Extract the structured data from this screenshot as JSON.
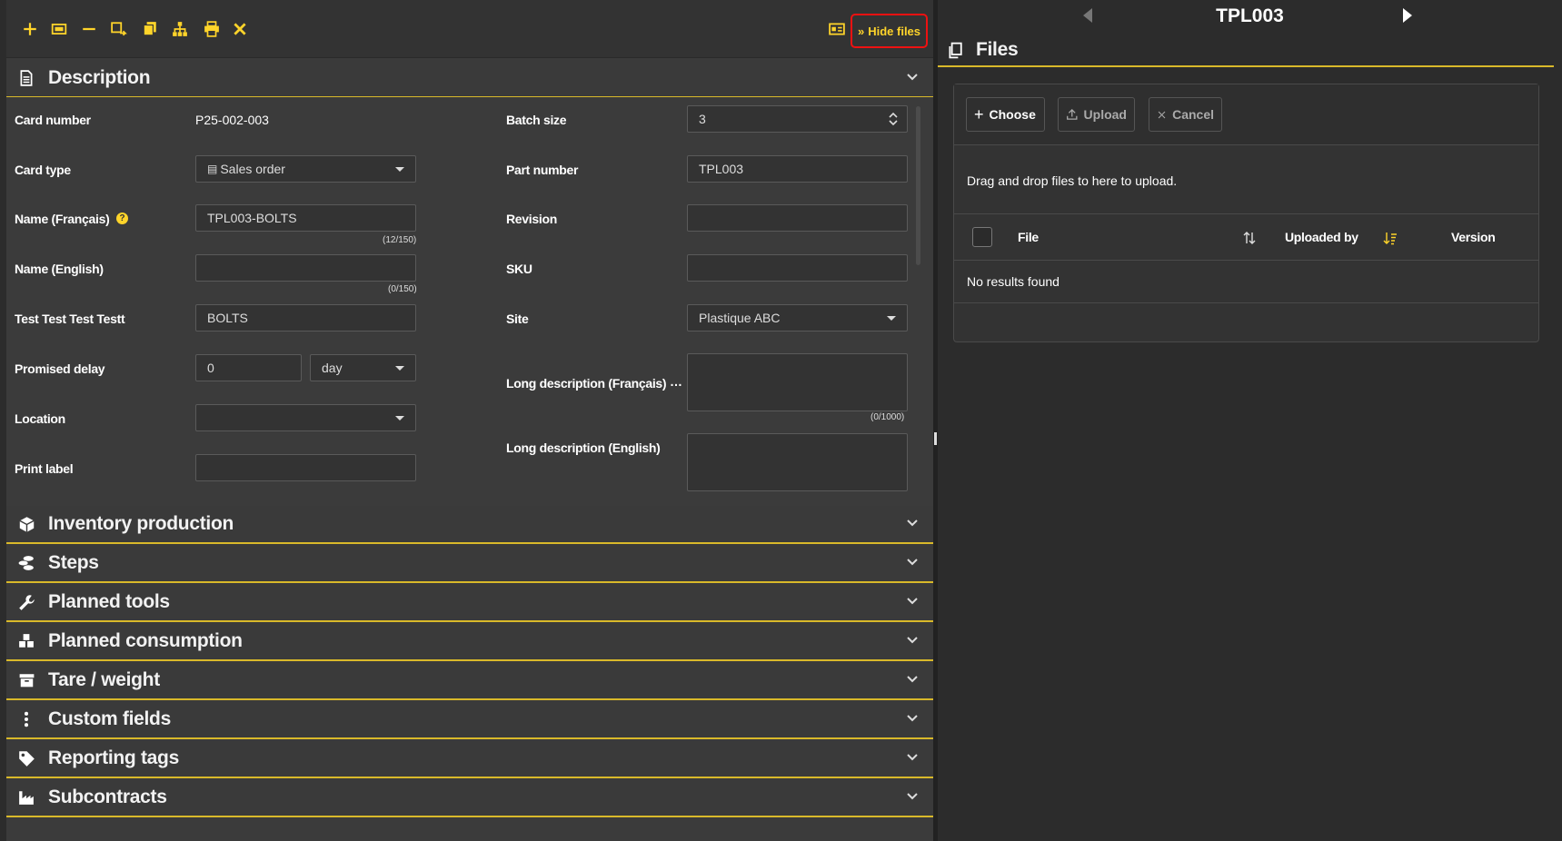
{
  "toolbar": {
    "buttons": [
      {
        "icon": "plus-icon"
      },
      {
        "icon": "card-icon"
      },
      {
        "icon": "minus-icon"
      },
      {
        "icon": "copy-move-icon"
      },
      {
        "icon": "duplicate-icon"
      },
      {
        "icon": "hierarchy-icon"
      },
      {
        "icon": "print-icon"
      },
      {
        "icon": "close-icon"
      }
    ],
    "hide_files_label": "Hide files"
  },
  "description": {
    "title": "Description",
    "left": {
      "card_number_label": "Card number",
      "card_number_value": "P25-002-003",
      "card_type_label": "Card type",
      "card_type_value": "Sales order",
      "name_fr_label": "Name (Français)",
      "name_fr_value": "TPL003-BOLTS",
      "name_fr_counter": "(12/150)",
      "name_en_label": "Name (English)",
      "name_en_value": "",
      "name_en_counter": "(0/150)",
      "test_label": "Test Test Test Testt",
      "test_value": "BOLTS",
      "promised_delay_label": "Promised delay",
      "promised_delay_value": "0",
      "promised_delay_unit": "day",
      "location_label": "Location",
      "location_value": "",
      "print_label_label": "Print label",
      "print_label_value": ""
    },
    "right": {
      "batch_size_label": "Batch size",
      "batch_size_value": "3",
      "part_number_label": "Part number",
      "part_number_value": "TPL003",
      "revision_label": "Revision",
      "sku_label": "SKU",
      "site_label": "Site",
      "site_value": "Plastique ABC",
      "long_desc_fr_label": "Long description (Français)",
      "long_desc_fr_counter": "(0/1000)",
      "long_desc_en_label": "Long description (English)"
    }
  },
  "sections": [
    {
      "title": "Inventory production",
      "icon": "box-icon"
    },
    {
      "title": "Steps",
      "icon": "steps-icon"
    },
    {
      "title": "Planned tools",
      "icon": "wrench-icon"
    },
    {
      "title": "Planned consumption",
      "icon": "cubes-icon"
    },
    {
      "title": "Tare / weight",
      "icon": "archive-icon"
    },
    {
      "title": "Custom fields",
      "icon": "vertical-dots-icon"
    },
    {
      "title": "Reporting tags",
      "icon": "tag-icon"
    },
    {
      "title": "Subcontracts",
      "icon": "industry-icon"
    }
  ],
  "right_panel": {
    "record_title": "TPL003",
    "files_title": "Files",
    "choose_label": "Choose",
    "upload_label": "Upload",
    "cancel_label": "Cancel",
    "drop_text": "Drag and drop files to here to upload.",
    "columns": [
      "File",
      "Uploaded by",
      "Version"
    ],
    "empty_text": "No results found"
  },
  "colors": {
    "accent": "#ffd42a",
    "panel_bg": "#3b3b3b",
    "right_bg": "#2c2c2c",
    "highlight_border": "#e11111"
  }
}
